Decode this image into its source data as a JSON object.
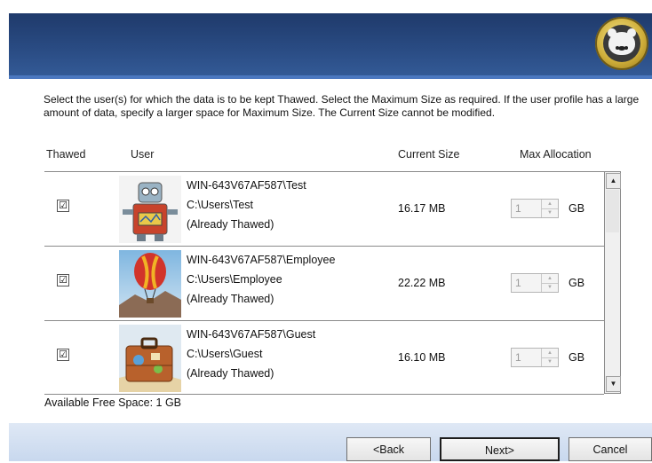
{
  "instructions": "Select the user(s) for which the data is to be kept Thawed. Select the Maximum Size as required. If the user profile has a large amount of data, specify a larger space for Maximum Size. The Current Size cannot be modified.",
  "columns": {
    "thawed": "Thawed",
    "user": "User",
    "current_size": "Current Size",
    "max_allocation": "Max Allocation"
  },
  "users": [
    {
      "account": "WIN-643V67AF587\\Test",
      "path": "C:\\Users\\Test",
      "status": "(Already Thawed)",
      "current_size": "16.17 MB",
      "max_value": "1",
      "unit": "GB",
      "checked": "☑",
      "thumbnail_icon": "robot-icon"
    },
    {
      "account": "WIN-643V67AF587\\Employee",
      "path": "C:\\Users\\Employee",
      "status": "(Already Thawed)",
      "current_size": "22.22 MB",
      "max_value": "1",
      "unit": "GB",
      "checked": "☑",
      "thumbnail_icon": "hot-air-balloon-icon"
    },
    {
      "account": "WIN-643V67AF587\\Guest",
      "path": "C:\\Users\\Guest",
      "status": "(Already Thawed)",
      "current_size": "16.10 MB",
      "max_value": "1",
      "unit": "GB",
      "checked": "☑",
      "thumbnail_icon": "suitcase-icon"
    }
  ],
  "free_space": "Available Free Space:  1 GB",
  "buttons": {
    "back": "<Back",
    "next": "Next>",
    "cancel": "Cancel"
  },
  "colors": {
    "header": "#2a4c84",
    "footer": "#c8d8ee"
  }
}
